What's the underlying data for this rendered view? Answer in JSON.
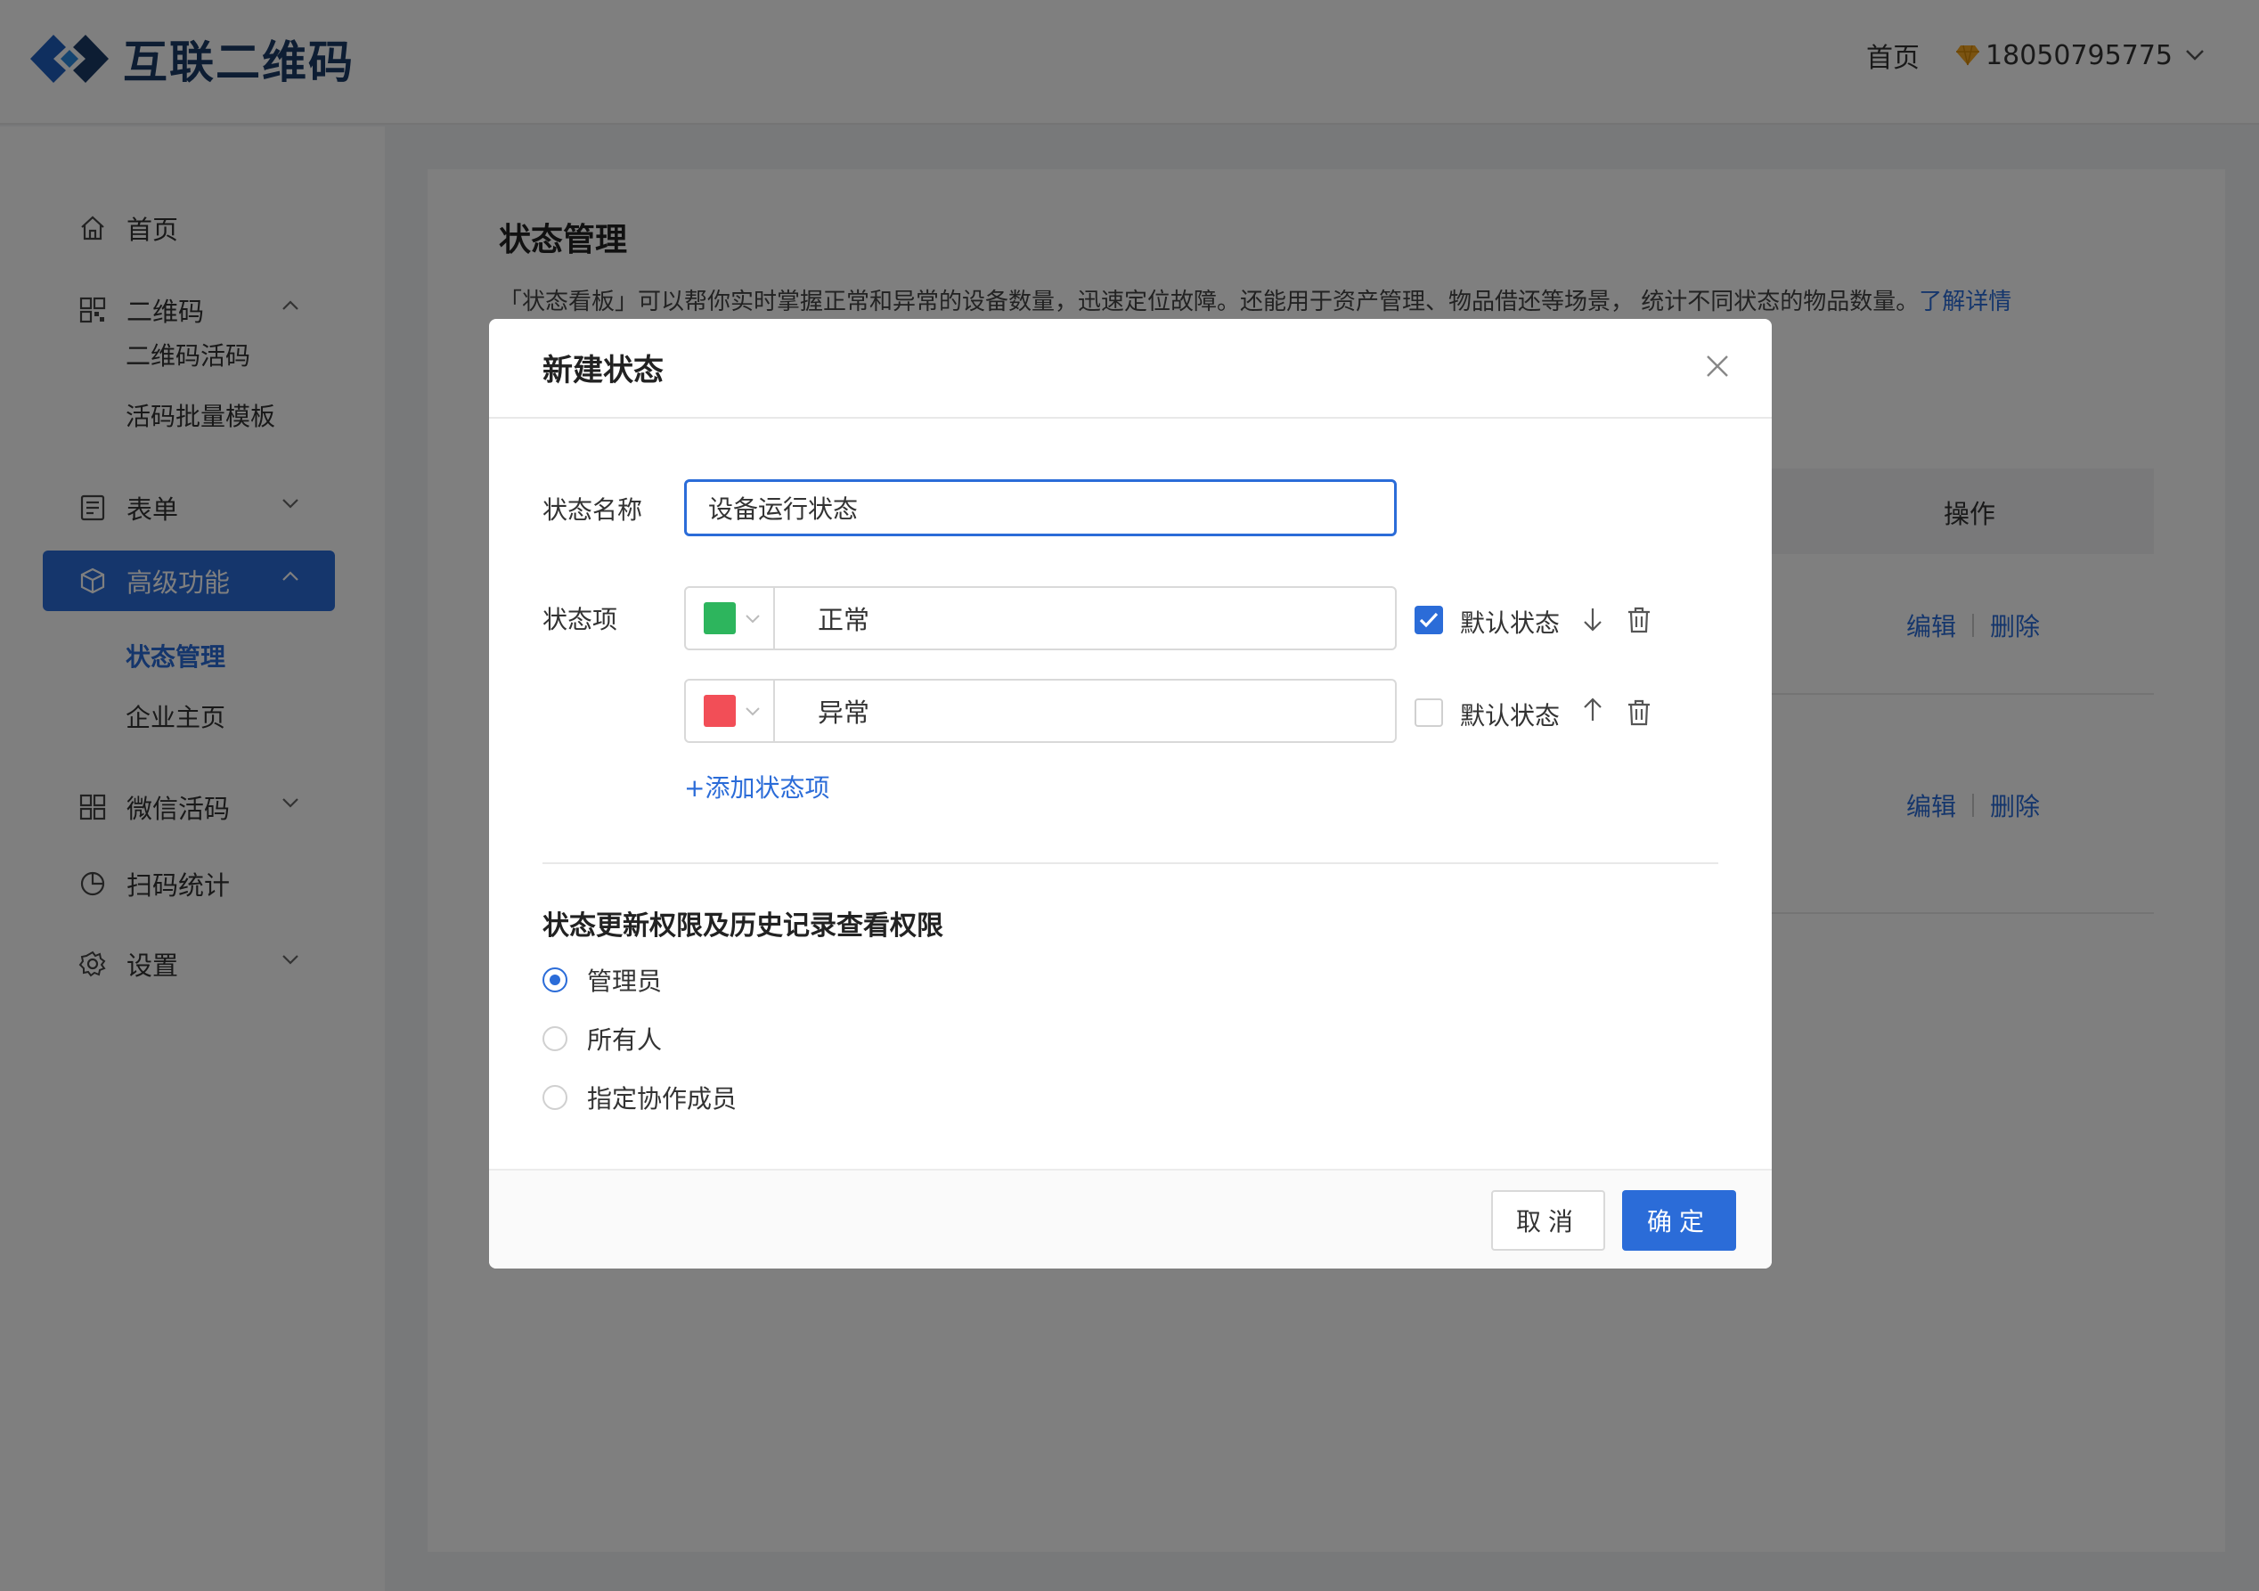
{
  "header": {
    "brand": "互联二维码",
    "home_link": "首页",
    "user_phone": "18050795775"
  },
  "sidebar": {
    "items": [
      {
        "label": "首页",
        "icon": "home-icon"
      },
      {
        "label": "二维码",
        "icon": "qrcode-icon",
        "expanded": true,
        "children": [
          "二维码活码",
          "活码批量模板"
        ]
      },
      {
        "label": "表单",
        "icon": "form-icon",
        "expanded": false
      },
      {
        "label": "高级功能",
        "icon": "cube-icon",
        "expanded": true,
        "active": true,
        "children": [
          "状态管理",
          "企业主页"
        ]
      },
      {
        "label": "微信活码",
        "icon": "wechat-qrcode-icon",
        "expanded": false
      },
      {
        "label": "扫码统计",
        "icon": "pie-chart-icon"
      },
      {
        "label": "设置",
        "icon": "gear-icon",
        "expanded": false
      }
    ],
    "active_child": "状态管理"
  },
  "main": {
    "title": "状态管理",
    "description": "「状态看板」可以帮你实时掌握正常和异常的设备数量，迅速定位故障。还能用于资产管理、物品借还等场景， 统计不同状态的物品数量。",
    "learn_more": "了解详情",
    "table_header_ops": "操作",
    "rows": [
      {
        "edit": "编辑",
        "delete": "删除"
      },
      {
        "edit": "编辑",
        "delete": "删除"
      }
    ]
  },
  "dialog": {
    "title": "新建状态",
    "name_label": "状态名称",
    "name_value": "设备运行状态",
    "items_label": "状态项",
    "items": [
      {
        "text": "正常",
        "color": "#2db55d",
        "default": true
      },
      {
        "text": "异常",
        "color": "#f24e57",
        "default": false
      }
    ],
    "default_label": "默认状态",
    "add_item": "+添加状态项",
    "perm_title": "状态更新权限及历史记录查看权限",
    "perm_options": [
      {
        "label": "管理员",
        "selected": true
      },
      {
        "label": "所有人",
        "selected": false
      },
      {
        "label": "指定协作成员",
        "selected": false
      }
    ],
    "cancel": "取消",
    "confirm": "确定"
  },
  "colors": {
    "accent": "#2b6cd8",
    "green": "#2db55d",
    "red": "#f24e57"
  }
}
